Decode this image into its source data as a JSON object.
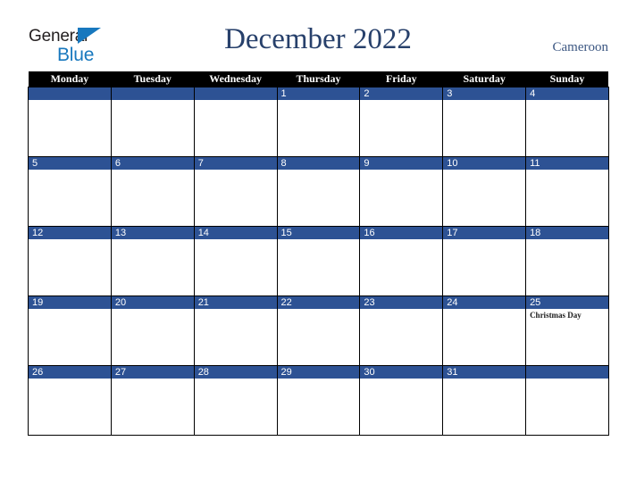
{
  "brand": {
    "name_part1": "General",
    "name_part2": "Blue",
    "triangle_color": "#1878be",
    "text_color": "#231f20"
  },
  "header": {
    "title": "December 2022",
    "country": "Cameroon",
    "title_color": "#27406b"
  },
  "calendar": {
    "weekday_headers": [
      "Monday",
      "Tuesday",
      "Wednesday",
      "Thursday",
      "Friday",
      "Saturday",
      "Sunday"
    ],
    "header_bg": "#000000",
    "header_text_color": "#ffffff",
    "date_bar_color": "#2d5294",
    "date_text_color": "#ffffff",
    "weeks": [
      [
        {
          "date": "",
          "events": []
        },
        {
          "date": "",
          "events": []
        },
        {
          "date": "",
          "events": []
        },
        {
          "date": "1",
          "events": []
        },
        {
          "date": "2",
          "events": []
        },
        {
          "date": "3",
          "events": []
        },
        {
          "date": "4",
          "events": []
        }
      ],
      [
        {
          "date": "5",
          "events": []
        },
        {
          "date": "6",
          "events": []
        },
        {
          "date": "7",
          "events": []
        },
        {
          "date": "8",
          "events": []
        },
        {
          "date": "9",
          "events": []
        },
        {
          "date": "10",
          "events": []
        },
        {
          "date": "11",
          "events": []
        }
      ],
      [
        {
          "date": "12",
          "events": []
        },
        {
          "date": "13",
          "events": []
        },
        {
          "date": "14",
          "events": []
        },
        {
          "date": "15",
          "events": []
        },
        {
          "date": "16",
          "events": []
        },
        {
          "date": "17",
          "events": []
        },
        {
          "date": "18",
          "events": []
        }
      ],
      [
        {
          "date": "19",
          "events": []
        },
        {
          "date": "20",
          "events": []
        },
        {
          "date": "21",
          "events": []
        },
        {
          "date": "22",
          "events": []
        },
        {
          "date": "23",
          "events": []
        },
        {
          "date": "24",
          "events": []
        },
        {
          "date": "25",
          "events": [
            "Christmas Day"
          ]
        }
      ],
      [
        {
          "date": "26",
          "events": []
        },
        {
          "date": "27",
          "events": []
        },
        {
          "date": "28",
          "events": []
        },
        {
          "date": "29",
          "events": []
        },
        {
          "date": "30",
          "events": []
        },
        {
          "date": "31",
          "events": []
        },
        {
          "date": "",
          "events": []
        }
      ]
    ]
  }
}
